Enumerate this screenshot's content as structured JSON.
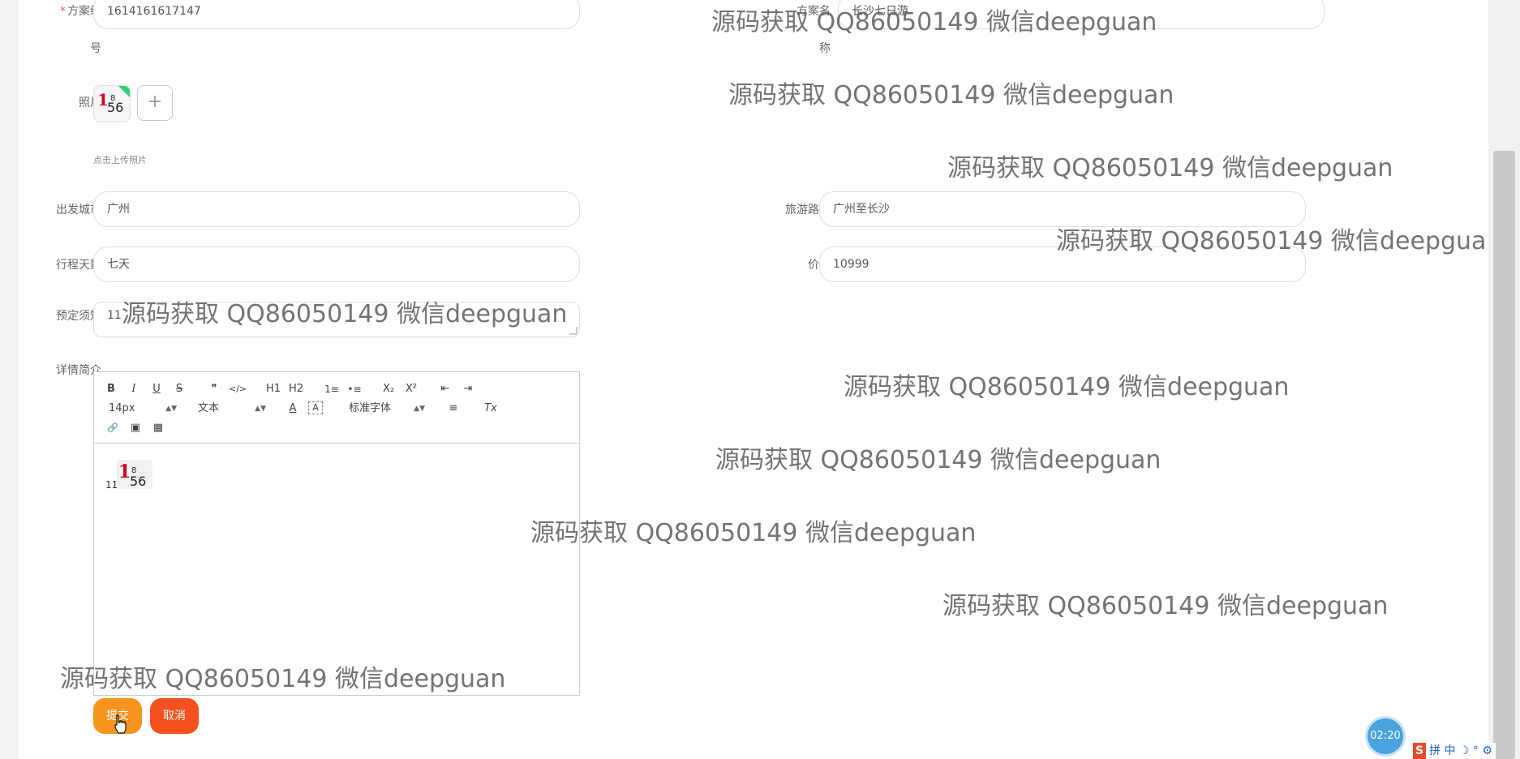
{
  "form": {
    "plan_no": {
      "label_line1": "方案编",
      "label_line2": "号",
      "required": "*",
      "value": "1614161617147"
    },
    "plan_name": {
      "label_line1": "方案名",
      "label_line2": "称",
      "value": "长沙七日游"
    },
    "photo": {
      "label": "照片",
      "add_symbol": "+",
      "hint": "点击上传照片"
    },
    "depart_city": {
      "label": "出发城市",
      "value": "广州"
    },
    "route": {
      "label": "旅游路线",
      "value": "广州至长沙"
    },
    "days": {
      "label": "行程天数",
      "value": "七天"
    },
    "price": {
      "label": "价格",
      "value": "10999"
    },
    "booking_notes": {
      "label": "预定须知",
      "value": "11"
    },
    "detail": {
      "label": "详情简介",
      "content_text": "11"
    }
  },
  "editor": {
    "toolbar_row1": {
      "bold": "B",
      "italic": "I",
      "underline": "U",
      "strike": "S",
      "quote": "❞",
      "code": "</>",
      "h1": "H1",
      "h2": "H2",
      "ordered_list": "1≡",
      "bullet_list": "•≡",
      "subscript": "X₂",
      "superscript": "X²",
      "outdent": "⇤",
      "indent": "⇥"
    },
    "size_select": "14px",
    "header_select": "文本",
    "font_select": "标准字体",
    "toolbar_row2": {
      "font_color": "A",
      "background": "A",
      "align": "≡",
      "clean": "Tx"
    },
    "toolbar_row3": {
      "link": "🔗",
      "image": "▣",
      "video": "▦"
    }
  },
  "buttons": {
    "submit": "提交",
    "cancel": "取消"
  },
  "watermark_text": "源码获取 QQ86050149 微信deepguan",
  "timer": "02:20",
  "ime": {
    "logo": "S",
    "text": "拼 中 ☽ ° ⚙"
  },
  "colors": {
    "submit": "#f7941d",
    "cancel": "#f4511e",
    "required": "#ff4d4f",
    "timer": "#4aa3df"
  }
}
